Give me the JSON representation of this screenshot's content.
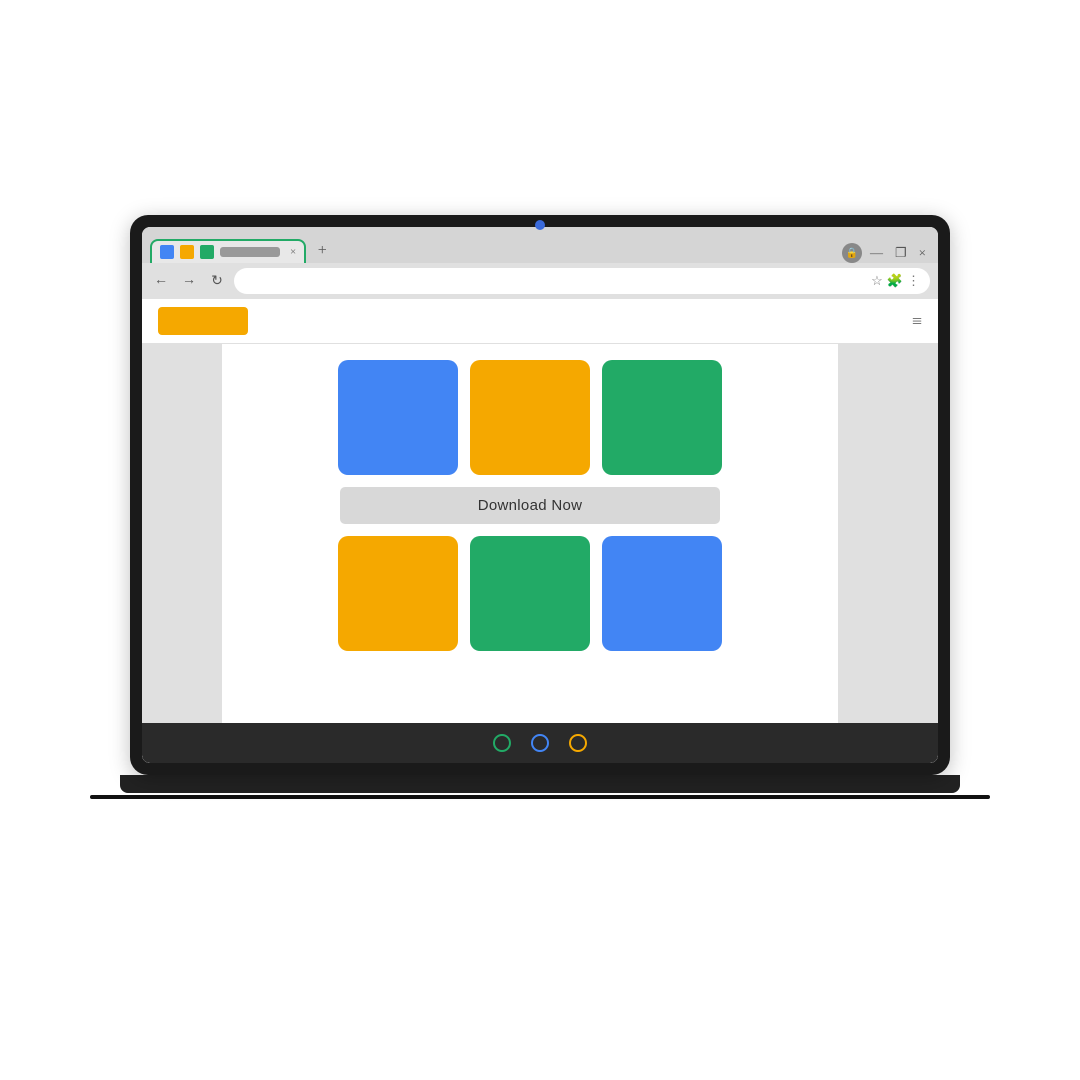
{
  "laptop": {
    "webcam_color": "#3a6adb"
  },
  "browser": {
    "tab": {
      "favicons": [
        "#4285f4",
        "#f5a800",
        "#22aa66"
      ],
      "active_border_color": "#22aa66",
      "close_label": "×",
      "new_tab_label": "+"
    },
    "nav": {
      "back_label": "←",
      "forward_label": "→",
      "reload_label": "↻"
    },
    "address_bar": {
      "star_label": "☆",
      "puzzle_label": "🧩",
      "menu_label": "⋮"
    },
    "window_controls": {
      "minimize_label": "—",
      "maximize_label": "❐",
      "close_label": "×"
    }
  },
  "site": {
    "header": {
      "hamburger_label": "≡"
    },
    "cards_row1": [
      {
        "color": "#4285f4"
      },
      {
        "color": "#f5a800"
      },
      {
        "color": "#22aa66"
      }
    ],
    "download_button_label": "Download Now",
    "cards_row2": [
      {
        "color": "#f5a800"
      },
      {
        "color": "#22aa66"
      },
      {
        "color": "#4285f4"
      }
    ]
  },
  "taskbar": {
    "dots": [
      {
        "color": "#22aa66"
      },
      {
        "color": "#4285f4"
      },
      {
        "color": "#f5a800"
      }
    ]
  }
}
